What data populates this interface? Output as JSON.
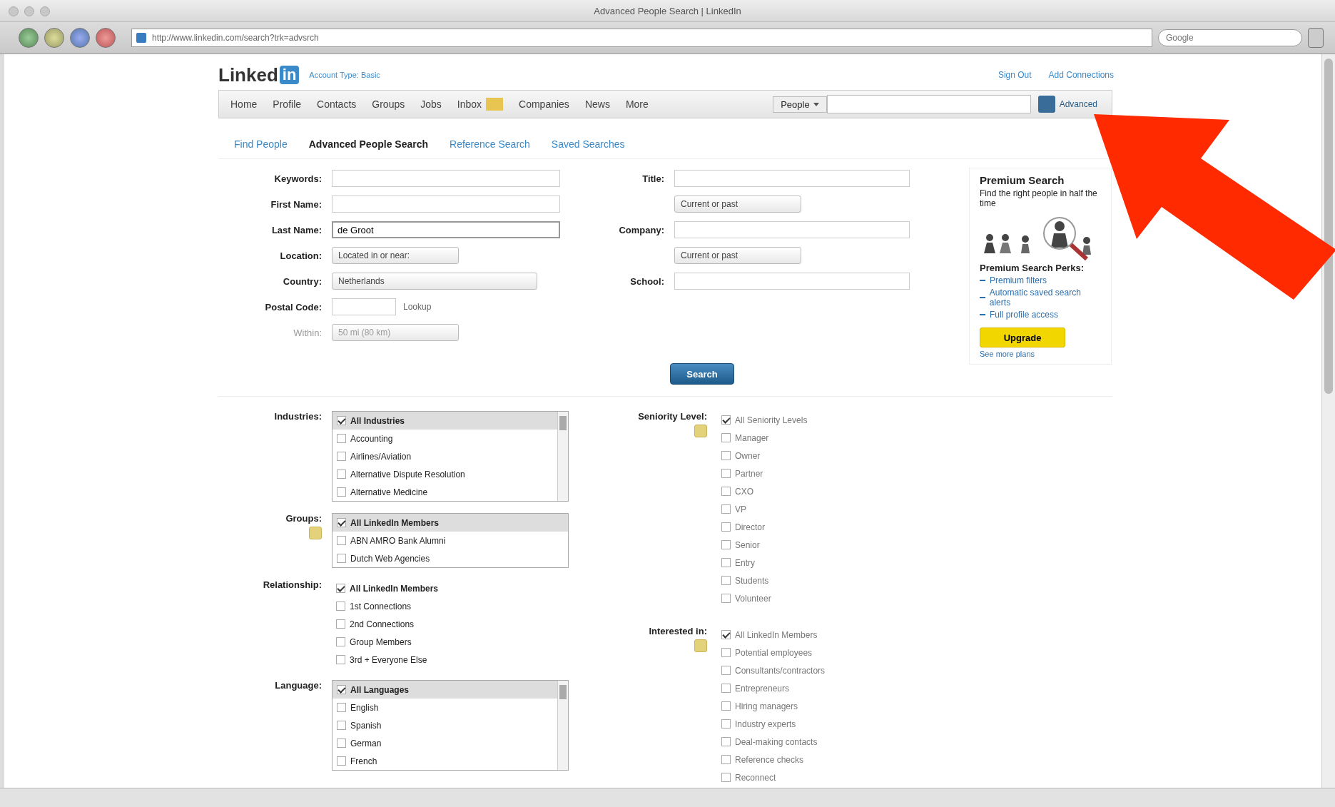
{
  "browser": {
    "title": "Advanced People Search | LinkedIn",
    "url": "http://www.linkedin.com/search?trk=advsrch",
    "search_placeholder": "Google"
  },
  "header": {
    "logo": "Linked",
    "logo_badge": "in",
    "tagline": "Account Type: Basic",
    "links": [
      "Sign Out",
      "Add Connections"
    ]
  },
  "nav": {
    "items": [
      {
        "label": "Home",
        "badge": false
      },
      {
        "label": "Profile",
        "badge": false
      },
      {
        "label": "Contacts",
        "badge": false
      },
      {
        "label": "Groups",
        "badge": false
      },
      {
        "label": "Jobs",
        "badge": false
      },
      {
        "label": "Inbox",
        "badge": true
      },
      {
        "label": "Companies",
        "badge": false
      },
      {
        "label": "News",
        "badge": false
      },
      {
        "label": "More",
        "badge": false
      }
    ],
    "scope": "People",
    "search_button": "Advanced"
  },
  "subtabs": [
    {
      "label": "Find People",
      "selected": false
    },
    {
      "label": "Advanced People Search",
      "selected": true
    },
    {
      "label": "Reference Search",
      "selected": false
    },
    {
      "label": "Saved Searches",
      "selected": false
    }
  ],
  "form_left": [
    {
      "label": "Keywords:",
      "kind": "text"
    },
    {
      "label": "First Name:",
      "kind": "text"
    },
    {
      "label": "Last Name:",
      "kind": "text",
      "value": "de Groot"
    },
    {
      "label": "Location:",
      "kind": "select",
      "value": "Located in or near:"
    },
    {
      "label": "Country:",
      "kind": "select",
      "value": "Netherlands"
    },
    {
      "label": "Postal Code:",
      "kind": "postal",
      "link": "Lookup"
    },
    {
      "label": "Within:",
      "kind": "within",
      "value": "50 mi (80 km)"
    }
  ],
  "form_right": [
    {
      "label": "Title:",
      "kind": "text"
    },
    {
      "kind": "select",
      "value": "Current or past"
    },
    {
      "label": "Company:",
      "kind": "text"
    },
    {
      "kind": "select",
      "value": "Current or past"
    },
    {
      "label": "School:",
      "kind": "text"
    }
  ],
  "search_button": "Search",
  "premium": {
    "title": "Premium Search",
    "text": "Find the right people in half the time",
    "perks_title": "Premium Search Perks:",
    "perks": [
      "Premium filters",
      "Automatic saved search alerts",
      "Full profile access"
    ],
    "button": "Upgrade",
    "link": "See more plans"
  },
  "filters_left": [
    {
      "label": "Industries:",
      "kind": "listbox",
      "scroll": true,
      "items": [
        {
          "label": "All Industries",
          "checked": true
        },
        {
          "label": "Accounting",
          "checked": false
        },
        {
          "label": "Airlines/Aviation",
          "checked": false
        },
        {
          "label": "Alternative Dispute Resolution",
          "checked": false
        },
        {
          "label": "Alternative Medicine",
          "checked": false
        }
      ]
    },
    {
      "label": "Groups:",
      "kind": "listbox",
      "scroll": false,
      "items": [
        {
          "label": "All LinkedIn Members",
          "checked": true
        },
        {
          "label": "ABN AMRO Bank Alumni",
          "checked": false
        },
        {
          "label": "Dutch Web Agencies",
          "checked": false
        }
      ]
    },
    {
      "label": "Relationship:",
      "kind": "checklist",
      "items": [
        {
          "label": "All LinkedIn Members",
          "checked": true
        },
        {
          "label": "1st Connections",
          "checked": false
        },
        {
          "label": "2nd Connections",
          "checked": false
        },
        {
          "label": "Group Members",
          "checked": false
        },
        {
          "label": "3rd + Everyone Else",
          "checked": false
        }
      ]
    },
    {
      "label": "Language:",
      "kind": "listbox",
      "scroll": true,
      "items": [
        {
          "label": "All Languages",
          "checked": true
        },
        {
          "label": "English",
          "checked": false
        },
        {
          "label": "Spanish",
          "checked": false
        },
        {
          "label": "German",
          "checked": false
        },
        {
          "label": "French",
          "checked": false
        }
      ]
    }
  ],
  "filters_right": [
    {
      "label": "Seniority Level:",
      "kind": "checklist",
      "items": [
        {
          "label": "All Seniority Levels",
          "checked": true
        },
        {
          "label": "Manager",
          "checked": false
        },
        {
          "label": "Owner",
          "checked": false
        },
        {
          "label": "Partner",
          "checked": false
        },
        {
          "label": "CXO",
          "checked": false
        },
        {
          "label": "VP",
          "checked": false
        },
        {
          "label": "Director",
          "checked": false
        },
        {
          "label": "Senior",
          "checked": false
        },
        {
          "label": "Entry",
          "checked": false
        },
        {
          "label": "Students",
          "checked": false
        },
        {
          "label": "Volunteer",
          "checked": false
        }
      ]
    },
    {
      "label": "Interested in:",
      "kind": "checklist",
      "items": [
        {
          "label": "All LinkedIn Members",
          "checked": true
        },
        {
          "label": "Potential employees",
          "checked": false
        },
        {
          "label": "Consultants/contractors",
          "checked": false
        },
        {
          "label": "Entrepreneurs",
          "checked": false
        },
        {
          "label": "Hiring managers",
          "checked": false
        },
        {
          "label": "Industry experts",
          "checked": false
        },
        {
          "label": "Deal-making contacts",
          "checked": false
        },
        {
          "label": "Reference checks",
          "checked": false
        },
        {
          "label": "Reconnect",
          "checked": false
        }
      ]
    }
  ]
}
